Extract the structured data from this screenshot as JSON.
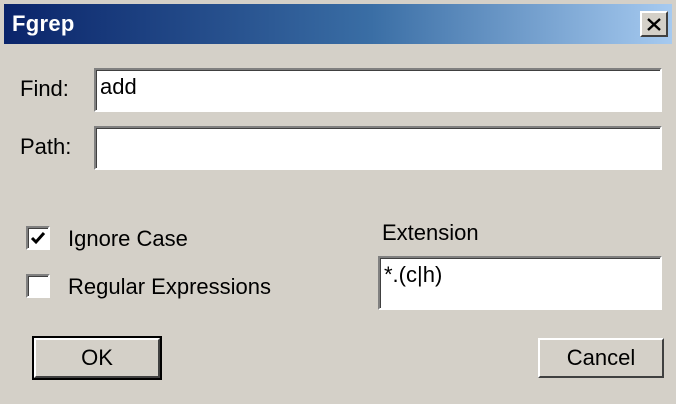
{
  "window": {
    "title": "Fgrep",
    "close_icon": "close-icon"
  },
  "find": {
    "label": "Find:",
    "value": "add"
  },
  "path": {
    "label": "Path:",
    "value": ""
  },
  "options": {
    "ignore_case": {
      "label": "Ignore Case",
      "checked": true
    },
    "regex": {
      "label": "Regular Expressions",
      "checked": false
    }
  },
  "extension": {
    "label": "Extension",
    "value": "*.(c|h)"
  },
  "buttons": {
    "ok": "OK",
    "cancel": "Cancel"
  },
  "colors": {
    "titlebar_start": "#0a246a",
    "titlebar_end": "#a6caf0",
    "face": "#d4d0c8"
  }
}
